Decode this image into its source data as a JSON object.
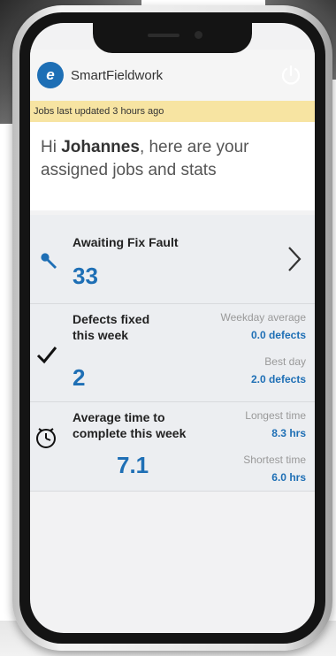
{
  "app": {
    "title": "SmartFieldwork",
    "logo_text": "e"
  },
  "banner": {
    "text": "Jobs last updated 3 hours ago"
  },
  "greeting": {
    "prefix": "Hi ",
    "name": "Johannes",
    "suffix": ", here are your assigned jobs and stats"
  },
  "cards": {
    "awaiting": {
      "label": "Awaiting Fix Fault",
      "value": "33"
    },
    "defects": {
      "label_line1": "Defects fixed",
      "label_line2": "this week",
      "value": "2",
      "stat1_label": "Weekday average",
      "stat1_value": "0.0 defects",
      "stat2_label": "Best day",
      "stat2_value": "2.0 defects"
    },
    "avgtime": {
      "label_line1": "Average time to",
      "label_line2": "complete this week",
      "value": "7.1",
      "stat1_label": "Longest time",
      "stat1_value": "8.3 hrs",
      "stat2_label": "Shortest time",
      "stat2_value": "6.0 hrs"
    }
  },
  "colors": {
    "accent": "#1e6fb5",
    "banner": "#f7e4a2",
    "card_bg": "#eceef1"
  },
  "icons": [
    "power-icon",
    "wrench-icon",
    "chevron-right-icon",
    "checkmark-icon",
    "clock-icon"
  ]
}
